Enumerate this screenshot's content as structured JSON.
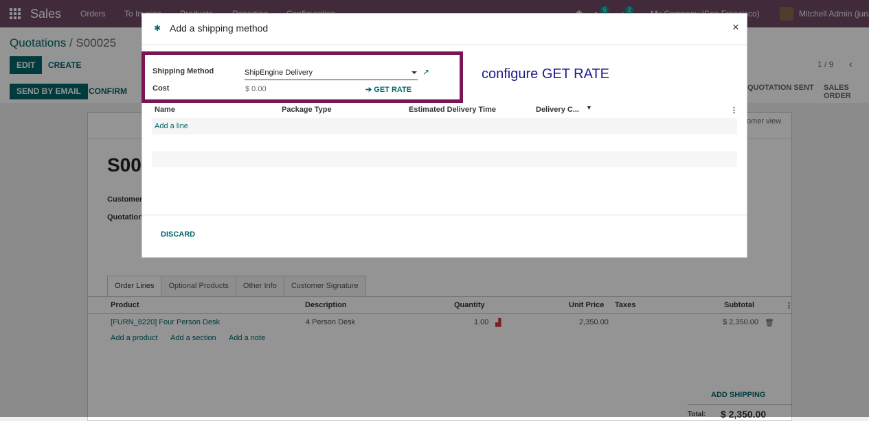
{
  "topbar": {
    "app": "Sales",
    "menu": [
      "Orders",
      "To Invoice",
      "Products",
      "Reporting",
      "Configuration"
    ],
    "chat_count": "5",
    "activity_count": "2",
    "company": "My Company (San Francisco)",
    "user": "Mitchell Admin (jun2"
  },
  "breadcrumb": {
    "parent": "Quotations",
    "sep": " / ",
    "current": "S00025"
  },
  "buttons": {
    "edit": "EDIT",
    "create": "CREATE",
    "send": "SEND BY EMAIL",
    "confirm": "CONFIRM"
  },
  "pager": "1 / 9",
  "stages": [
    "QUOTATION SENT",
    "SALES ORDER"
  ],
  "sheet": {
    "title": "S00",
    "customer_label": "Customer",
    "quotation_label": "Quotation",
    "smart_button": "tomer view"
  },
  "order_tabs": [
    "Order Lines",
    "Optional Products",
    "Other Info",
    "Customer Signature"
  ],
  "order_columns": [
    "Product",
    "Description",
    "Quantity",
    "Unit Price",
    "Taxes",
    "Subtotal"
  ],
  "order_row": {
    "product": "[FURN_8220] Four Person Desk",
    "description": "4 Person Desk",
    "quantity": "1.00",
    "unit_price": "2,350.00",
    "subtotal": "$ 2,350.00"
  },
  "order_add": [
    "Add a product",
    "Add a section",
    "Add a note"
  ],
  "add_shipping": "ADD SHIPPING",
  "total": {
    "label": "Total:",
    "value": "$ 2,350.00"
  },
  "modal": {
    "title": "Add a shipping method",
    "close": "×",
    "shipping_method_label": "Shipping Method",
    "shipping_method_value": "ShipEngine Delivery",
    "cost_label": "Cost",
    "cost_value": "$ 0.00",
    "get_rate": "GET RATE",
    "annotation": "configure GET RATE",
    "columns": [
      "Name",
      "Package Type",
      "Estimated Delivery Time",
      "Delivery C..."
    ],
    "add_line": "Add a line",
    "discard": "DISCARD"
  },
  "colors": {
    "brand": "#714B67",
    "accent": "#01666b",
    "highlight": "#7a1452",
    "annotation": "#1a1a8c"
  }
}
